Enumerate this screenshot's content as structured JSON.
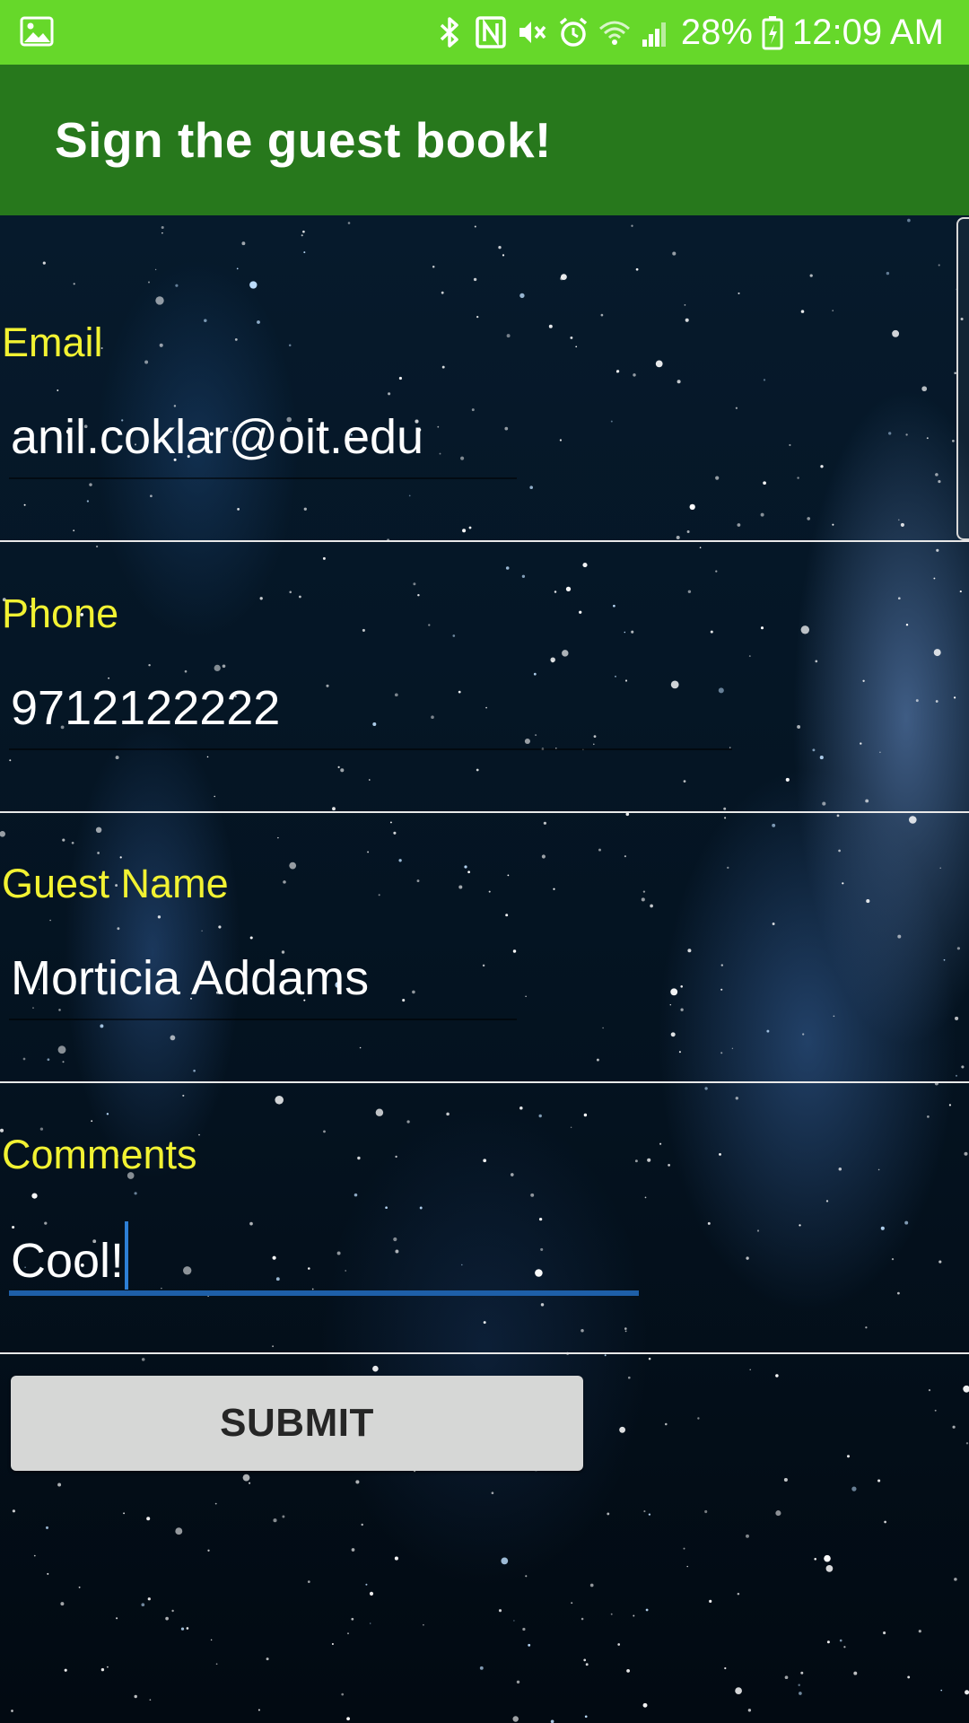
{
  "status_bar": {
    "battery": "28%",
    "time": "12:09 AM",
    "icons": [
      "gallery-icon",
      "bluetooth-icon",
      "nfc-icon",
      "vibrate-mute-icon",
      "alarm-icon",
      "wifi-icon",
      "signal-icon",
      "battery-icon"
    ],
    "background": "#66d82a"
  },
  "app_bar": {
    "title": "Sign the guest book!",
    "background": "#27781c"
  },
  "form": {
    "email": {
      "label": "Email",
      "value": "anil.coklar@oit.edu"
    },
    "phone": {
      "label": "Phone",
      "value": "9712122222"
    },
    "guest_name": {
      "label": "Guest Name",
      "value": "Morticia Addams"
    },
    "comments": {
      "label": "Comments",
      "value": "Cool!"
    },
    "label_color": "#f2f232",
    "focus_color": "#1e5fa8"
  },
  "submit": {
    "label": "SUBMIT"
  }
}
